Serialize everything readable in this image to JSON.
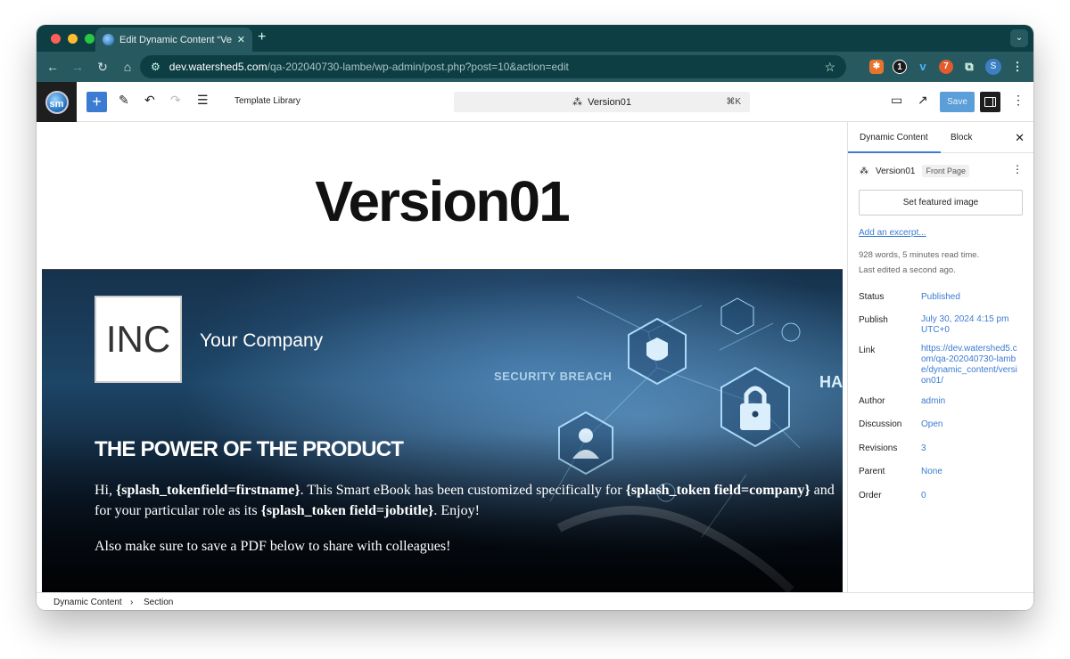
{
  "browser": {
    "tab_title": "Edit Dynamic Content “Versio",
    "url_host": "dev.watershed5.com",
    "url_path": "/qa-202040730-lambe/wp-admin/post.php?post=10&action=edit",
    "profile_initial": "S"
  },
  "editor": {
    "template_library_label": "Template Library",
    "command_title": "Version01",
    "command_shortcut": "⌘K",
    "save_label": "Save"
  },
  "canvas": {
    "page_title": "Version01",
    "logo_text": "INC",
    "company_name": "Your Company",
    "security_text": "SECURITY BREACH",
    "ha_text": "HA",
    "heading": "THE POWER OF THE PRODUCT",
    "body_hi": "Hi, ",
    "token_firstname": "{splash_tokenfield=firstname}",
    "body_mid": ". This Smart eBook has been customized specifically for ",
    "token_company": "{splash_token field=company}",
    "body_role": " and for your particular role as its ",
    "token_jobtitle": "{splash_token field=jobtitle}",
    "body_end": ". Enjoy!",
    "body2": "Also make sure to save a PDF below to share with colleagues!"
  },
  "breadcrumb": {
    "items": [
      "Dynamic Content",
      "Section"
    ],
    "separator": "›"
  },
  "sidebar": {
    "tabs": [
      "Dynamic Content",
      "Block"
    ],
    "post_name": "Version01",
    "post_badge": "Front Page",
    "featured_image_label": "Set featured image",
    "excerpt_link": "Add an excerpt...",
    "word_count_text": "928 words, 5 minutes read time.",
    "last_edited_text": "Last edited a second ago.",
    "properties": [
      {
        "label": "Status",
        "value": "Published"
      },
      {
        "label": "Publish",
        "value": "July 30, 2024 4:15 pm UTC+0"
      },
      {
        "label": "Link",
        "value": "https://dev.watershed5.com/qa-202040730-lambe/dynamic_content/version01/"
      },
      {
        "label": "Author",
        "value": "admin"
      },
      {
        "label": "Discussion",
        "value": "Open"
      },
      {
        "label": "Revisions",
        "value": "3"
      },
      {
        "label": "Parent",
        "value": "None"
      },
      {
        "label": "Order",
        "value": "0"
      }
    ]
  },
  "colors": {
    "accent": "#3b7bd1",
    "browser_frame": "#0d3e44",
    "browser_toolbar": "#275a60"
  }
}
